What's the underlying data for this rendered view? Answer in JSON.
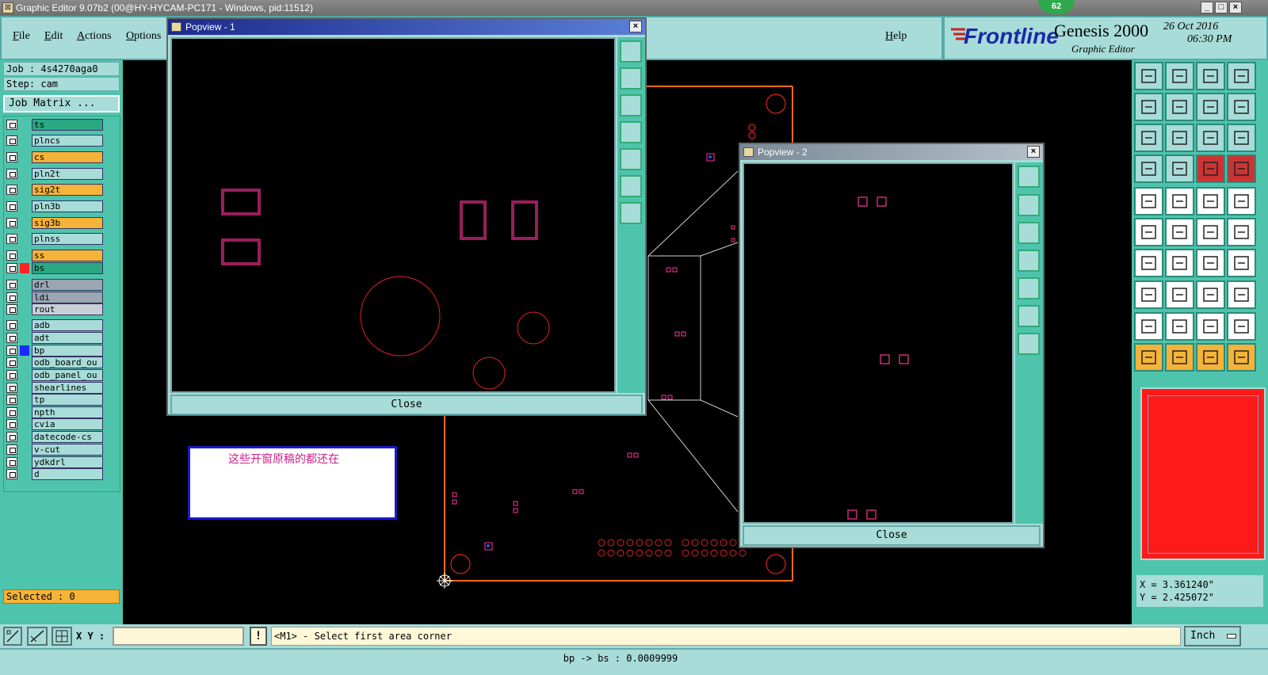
{
  "window": {
    "title": "Graphic Editor 9.07b2 (00@HY-HYCAM-PC171 - Windows, pid:11512)",
    "notification_count": "62",
    "controls": {
      "minimize": "_",
      "maximize": "□",
      "close": "×"
    }
  },
  "menu": {
    "file": "File",
    "edit": "Edit",
    "actions": "Actions",
    "options": "Options",
    "help": "Help"
  },
  "brand": {
    "logo": "Frontline",
    "product": "Genesis 2000",
    "subtitle": "Graphic Editor",
    "date": "26 Oct 2016",
    "time": "06:30 PM",
    "color": "#cc2222"
  },
  "job": {
    "job_label": "Job : 4s4270aga0",
    "step_label": "Step: cam",
    "matrix_button": "Job Matrix ..."
  },
  "layers": [
    {
      "name": "ts",
      "color": "#2aa882"
    },
    {
      "name": "plncs",
      "color": "#a7dcd8"
    },
    {
      "name": "cs",
      "color": "#f5b338"
    },
    {
      "name": "pln2t",
      "color": "#a7dcd8"
    },
    {
      "name": "sig2t",
      "color": "#f5b338"
    },
    {
      "name": "pln3b",
      "color": "#a7dcd8"
    },
    {
      "name": "sig3b",
      "color": "#f5b338"
    },
    {
      "name": "plnss",
      "color": "#a7dcd8"
    },
    {
      "name": "ss",
      "color": "#f5b338"
    },
    {
      "name": "bs",
      "color": "#2aa882"
    },
    {
      "name": "drl",
      "color": "#9aa6b0"
    },
    {
      "name": "ldi",
      "color": "#9aa6b0"
    },
    {
      "name": "rout",
      "color": "#c8d0d6"
    },
    {
      "name": "adb",
      "color": "#a7dcd8"
    },
    {
      "name": "adt",
      "color": "#a7dcd8"
    },
    {
      "name": "bp",
      "color": "#a7dcd8"
    },
    {
      "name": "odb_board_ou",
      "color": "#a7dcd8"
    },
    {
      "name": "odb_panel_ou",
      "color": "#a7dcd8"
    },
    {
      "name": "shearlines",
      "color": "#a7dcd8"
    },
    {
      "name": "tp",
      "color": "#a7dcd8"
    },
    {
      "name": "npth",
      "color": "#a7dcd8"
    },
    {
      "name": "cvia",
      "color": "#a7dcd8"
    },
    {
      "name": "datecode-cs",
      "color": "#a7dcd8"
    },
    {
      "name": "v-cut",
      "color": "#a7dcd8"
    },
    {
      "name": "ydkdrl",
      "color": "#a7dcd8"
    },
    {
      "name": "d",
      "color": "#a7dcd8"
    }
  ],
  "selected": "Selected : 0",
  "popview1": {
    "title": "Popview - 1",
    "close": "Close"
  },
  "popview2": {
    "title": "Popview - 2",
    "close": "Close"
  },
  "note": "这些开窗原稿的都还在",
  "coords": {
    "x": "X = 3.361240\"",
    "y": "Y = 2.425072\""
  },
  "command": {
    "xy_label": "X Y :",
    "xy_value": "",
    "prompt": "<M1> - Select first area corner",
    "units": "Inch"
  },
  "status": "bp -> bs : 0.0009999",
  "colors": {
    "accent": "#a7dcd8",
    "panel": "#4fc4ad",
    "highlight": "#f5b338",
    "active_layer": "#ff2222"
  }
}
